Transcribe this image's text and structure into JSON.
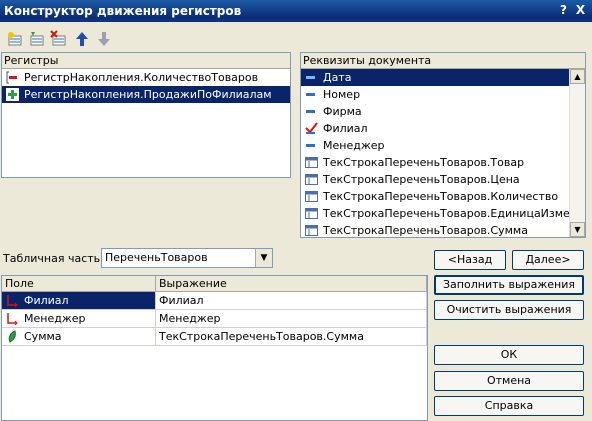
{
  "window": {
    "title": "Конструктор движения регистров",
    "help_label": "?",
    "close_label": "X"
  },
  "toolbar": {
    "icons": [
      "add-register-icon",
      "add-register-alt-icon",
      "delete-register-icon",
      "move-up-icon",
      "move-down-icon"
    ]
  },
  "registers": {
    "header": "Регистры",
    "items": [
      {
        "label": "РегистрНакопления.КоличествоТоваров",
        "icon": "accumulation-register-minus-icon",
        "selected": false
      },
      {
        "label": "РегистрНакопления.ПродажиПоФилиалам",
        "icon": "accumulation-register-plus-icon",
        "selected": true
      }
    ]
  },
  "attributes": {
    "header": "Реквизиты документа",
    "items": [
      {
        "label": "Дата",
        "icon": "attribute-icon",
        "selected": true
      },
      {
        "label": "Номер",
        "icon": "attribute-icon",
        "selected": false
      },
      {
        "label": "Фирма",
        "icon": "attribute-icon",
        "selected": false
      },
      {
        "label": "Филиал",
        "icon": "checkmark-attribute-icon",
        "selected": false
      },
      {
        "label": "Менеджер",
        "icon": "attribute-icon",
        "selected": false
      },
      {
        "label": "ТекСтрокаПереченьТоваров.Товар",
        "icon": "table-attribute-icon",
        "selected": false
      },
      {
        "label": "ТекСтрокаПереченьТоваров.Цена",
        "icon": "table-attribute-icon",
        "selected": false
      },
      {
        "label": "ТекСтрокаПереченьТоваров.Количество",
        "icon": "table-attribute-icon",
        "selected": false
      },
      {
        "label": "ТекСтрокаПереченьТоваров.ЕдиницаИзмерен...",
        "icon": "table-attribute-icon",
        "selected": false
      },
      {
        "label": "ТекСтрокаПереченьТоваров.Сумма",
        "icon": "table-attribute-icon",
        "selected": false
      }
    ]
  },
  "tabular": {
    "label": "Табличная часть:",
    "value": "ПереченьТоваров"
  },
  "grid": {
    "columns": [
      "Поле",
      "Выражение"
    ],
    "rows": [
      {
        "field": "Филиал",
        "expression": "Филиал",
        "icon": "dimension-icon",
        "selected": true
      },
      {
        "field": "Менеджер",
        "expression": "Менеджер",
        "icon": "dimension-icon",
        "selected": false
      },
      {
        "field": "Сумма",
        "expression": "ТекСтрокаПереченьТоваров.Сумма",
        "icon": "resource-icon",
        "selected": false
      }
    ]
  },
  "buttons": {
    "back": "<Назад",
    "next": "Далее>",
    "fill": "Заполнить выражения",
    "clear": "Очистить выражения",
    "ok": "ОК",
    "cancel": "Отмена",
    "help": "Справка"
  }
}
